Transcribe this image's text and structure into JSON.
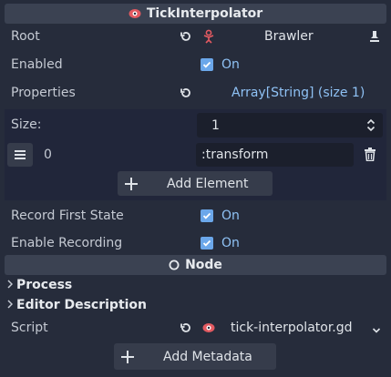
{
  "header": {
    "title": "TickInterpolator",
    "node_title": "Node"
  },
  "props": {
    "root": {
      "label": "Root",
      "value": "Brawler"
    },
    "enabled": {
      "label": "Enabled",
      "value": "On"
    },
    "properties": {
      "label": "Properties",
      "value": "Array[String] (size 1)"
    },
    "size": {
      "label": "Size:",
      "value": "1"
    },
    "element0": {
      "index": "0",
      "value": ":transform"
    },
    "add_element": "Add Element",
    "record_first_state": {
      "label": "Record First State",
      "value": "On"
    },
    "enable_recording": {
      "label": "Enable Recording",
      "value": "On"
    }
  },
  "node": {
    "process": "Process",
    "editor_description": "Editor Description",
    "script": {
      "label": "Script",
      "value": "tick-interpolator.gd"
    },
    "add_metadata": "Add Metadata"
  },
  "colors": {
    "background": "#262c3b",
    "header": "#3b4252",
    "accent": "#6ba7ea",
    "link": "#8fc2f5",
    "field": "#1b1f2c"
  }
}
